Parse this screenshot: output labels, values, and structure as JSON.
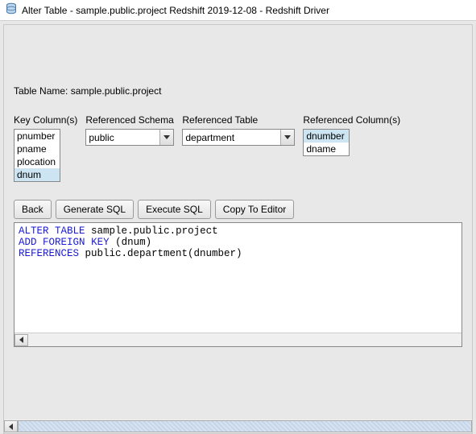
{
  "window": {
    "title": "Alter Table - sample.public.project Redshift 2019-12-08 - Redshift Driver"
  },
  "tableName": {
    "label": "Table Name: ",
    "value": "sample.public.project"
  },
  "headers": {
    "keyColumns": "Key Column(s)",
    "refSchema": "Referenced Schema",
    "refTable": "Referenced Table",
    "refColumns": "Referenced Column(s)"
  },
  "keyColumns": [
    "pnumber",
    "pname",
    "plocation",
    "dnum"
  ],
  "keyColumnsSelectedIndex": 3,
  "refSchema": "public",
  "refTable": "department",
  "refColumns": [
    "dnumber",
    "dname"
  ],
  "refColumnsSelectedIndex": 0,
  "buttons": {
    "back": "Back",
    "generate": "Generate SQL",
    "execute": "Execute SQL",
    "copy": "Copy To Editor"
  },
  "sql": {
    "l1a": "ALTER",
    "l1b": "TABLE",
    "l1c": " sample.public.project",
    "l2a": "ADD",
    "l2b": "FOREIGN",
    "l2c": "KEY",
    "l2d": " (dnum)",
    "l3a": "REFERENCES",
    "l3b": " public.department(dnumber)"
  }
}
